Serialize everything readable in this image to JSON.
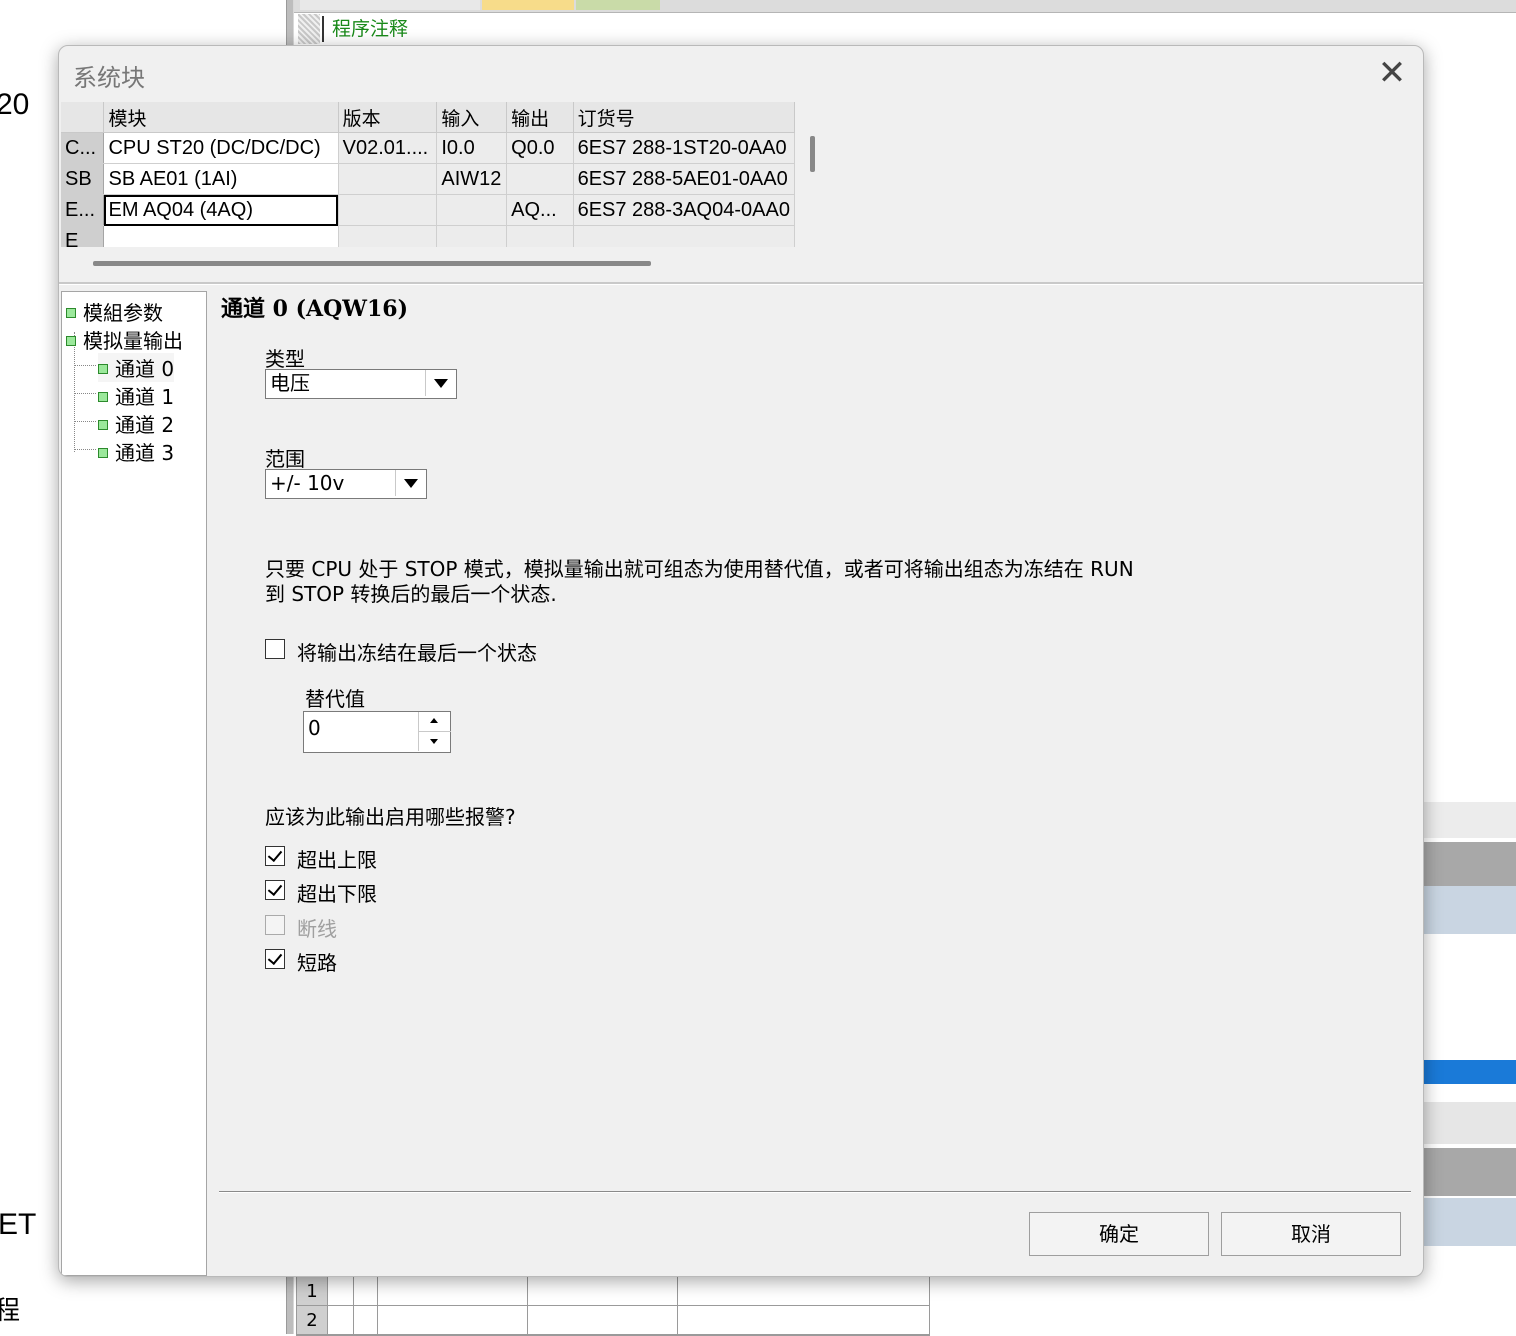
{
  "background": {
    "editor_comment": "程序注释",
    "left_fragments": [
      "20",
      "ET",
      "程"
    ],
    "grid_rows": [
      "1",
      "2"
    ]
  },
  "dialog": {
    "title": "系统块",
    "close_icon": "close-icon",
    "module_table": {
      "headers": [
        "",
        "模块",
        "版本",
        "输入",
        "输出",
        "订货号"
      ],
      "rows": [
        {
          "slot": "C...",
          "module": "CPU ST20 (DC/DC/DC)",
          "version": "V02.01....",
          "input": "I0.0",
          "output": "Q0.0",
          "order": "6ES7 288-1ST20-0AA0"
        },
        {
          "slot": "SB",
          "module": "SB AE01 (1AI)",
          "version": "",
          "input": "AIW12",
          "output": "",
          "order": "6ES7 288-5AE01-0AA0"
        },
        {
          "slot": "E...",
          "module": "EM AQ04 (4AQ)",
          "version": "",
          "input": "",
          "output": "AQ...",
          "order": "6ES7 288-3AQ04-0AA0"
        },
        {
          "slot": "E",
          "module": "",
          "version": "",
          "input": "",
          "output": "",
          "order": ""
        }
      ]
    },
    "tree": {
      "items": [
        {
          "label": "模組参数"
        },
        {
          "label": "模拟量输出"
        },
        {
          "label": "通道 0"
        },
        {
          "label": "通道 1"
        },
        {
          "label": "通道 2"
        },
        {
          "label": "通道 3"
        }
      ]
    },
    "content": {
      "channel_title": "通道 0 (AQW16)",
      "type_label": "类型",
      "type_value": "电压",
      "range_label": "范围",
      "range_value": "+/- 10v",
      "description_line1": "只要 CPU 处于 STOP 模式，模拟量输出就可组态为使用替代值，或者可将输出组态为冻结在 RUN",
      "description_line2": "到 STOP 转换后的最后一个状态.",
      "freeze_label": "将输出冻结在最后一个状态",
      "freeze_checked": false,
      "substitute_label": "替代值",
      "substitute_value": "0",
      "alarm_question": "应该为此输出启用哪些报警?",
      "alarms": [
        {
          "label": "超出上限",
          "checked": true,
          "enabled": true
        },
        {
          "label": "超出下限",
          "checked": true,
          "enabled": true
        },
        {
          "label": "断线",
          "checked": false,
          "enabled": false
        },
        {
          "label": "短路",
          "checked": true,
          "enabled": true
        }
      ]
    },
    "buttons": {
      "ok": "确定",
      "cancel": "取消"
    }
  }
}
